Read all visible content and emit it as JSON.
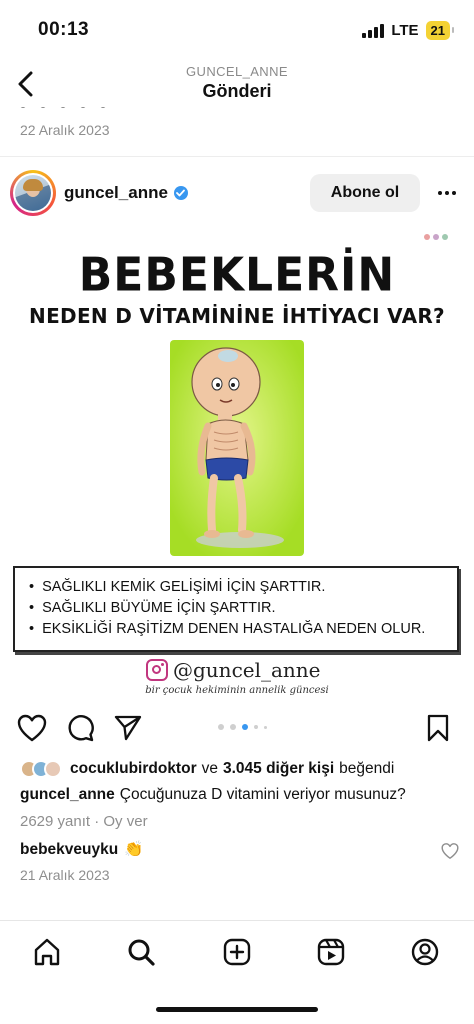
{
  "status_bar": {
    "time": "00:13",
    "network": "LTE",
    "battery": "21"
  },
  "nav": {
    "overline": "GUNCEL_ANNE",
    "title": "Gönderi",
    "back_icon": "chevron-left-icon"
  },
  "previous_post": {
    "date": "22 Aralık 2023"
  },
  "post": {
    "username": "guncel_anne",
    "verified": true,
    "follow_label": "Abone ol",
    "image": {
      "headline": "BEBEKLERİN",
      "subheadline": "NEDEN D VİTAMİNİNE İHTİYACI VAR?",
      "bullets": [
        "SAĞLIKLI KEMİK GELİŞİMİ İÇİN ŞARTTIR.",
        "SAĞLIKLI BÜYÜME İÇİN ŞARTTIR.",
        "EKSİKLİĞİ RAŞİTİZM DENEN HASTALIĞA NEDEN OLUR."
      ],
      "brand_handle": "@guncel_anne",
      "brand_tagline": "bir çocuk hekiminin annelik güncesi"
    },
    "carousel": {
      "total": 5,
      "active_index": 2
    },
    "likes": {
      "first_liker": "cocuklubirdoktor",
      "connector": "ve",
      "others": "3.045 diğer kişi",
      "suffix": "beğendi"
    },
    "caption": {
      "username": "guncel_anne",
      "text": "Çocuğunuza D vitamini veriyor musunuz?"
    },
    "reply_meta": "2629 yanıt · Oy ver",
    "top_comment": {
      "username": "bebekveuyku",
      "text": "👏"
    },
    "date": "21 Aralık 2023"
  },
  "tabbar": [
    "home-icon",
    "search-icon",
    "create-icon",
    "reels-icon",
    "profile-icon"
  ],
  "colors": {
    "accent": "#3897f0",
    "muted": "#8e8e8e",
    "follow_bg": "#efefef",
    "illustration_bg": "#b9e63a"
  }
}
